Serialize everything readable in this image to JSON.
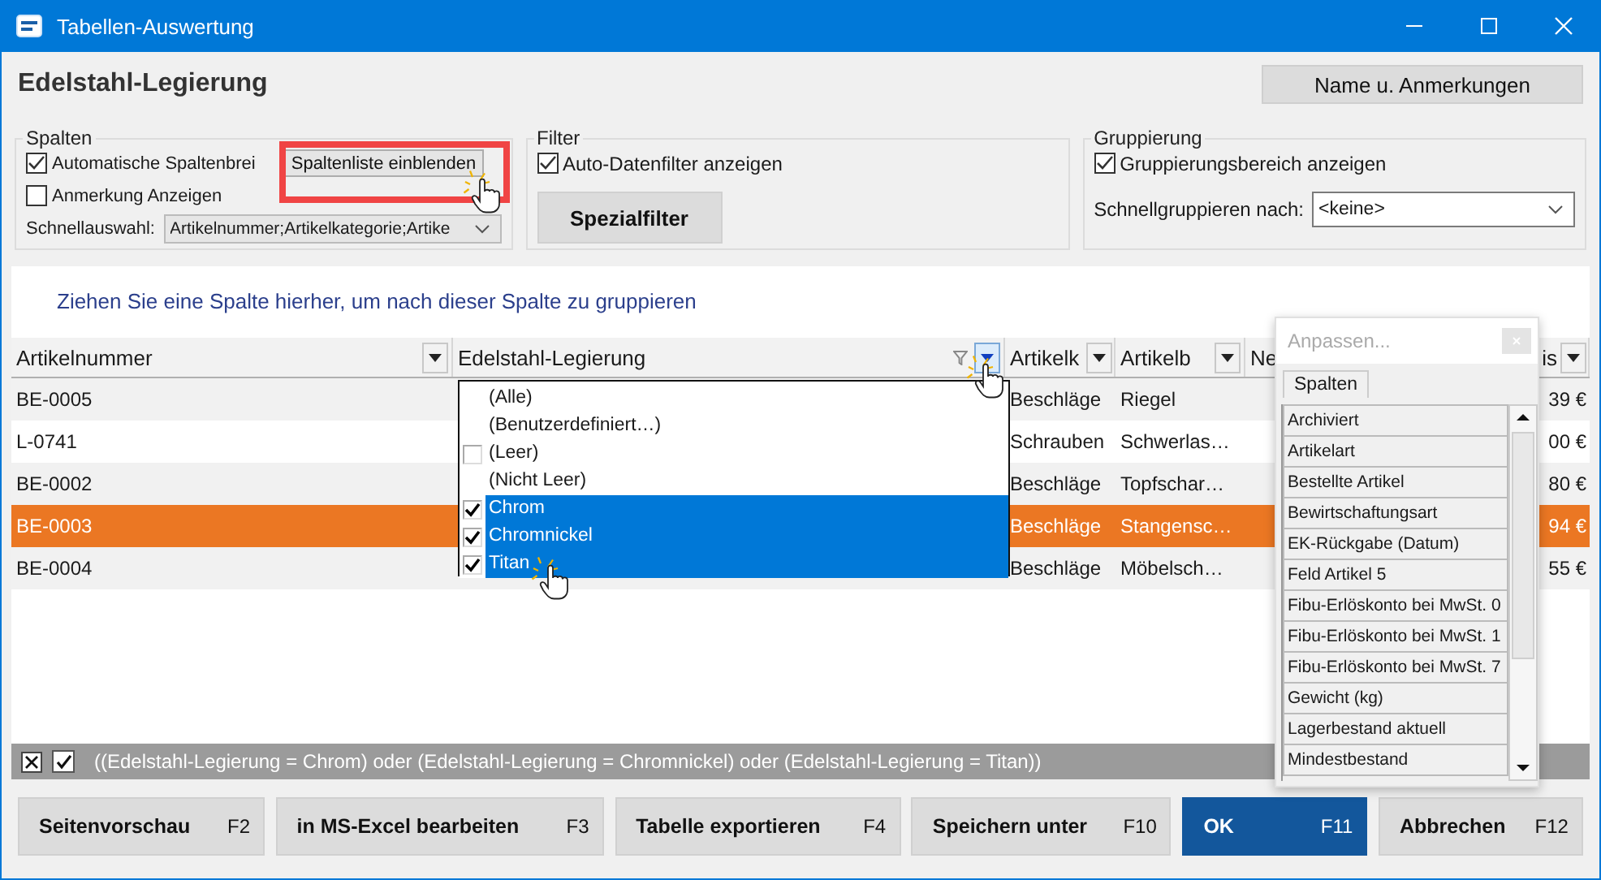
{
  "window": {
    "title": "Tabellen-Auswertung"
  },
  "header": {
    "title": "Edelstahl-Legierung",
    "button": "Name u. Anmerkungen"
  },
  "columns_group": {
    "title": "Spalten",
    "auto_width": {
      "label": "Automatische Spaltenbrei",
      "checked": true
    },
    "show_list_button": "Spaltenliste einblenden",
    "show_notes": {
      "label": "Anmerkung Anzeigen",
      "checked": false
    },
    "quick_select": {
      "label": "Schnellauswahl:",
      "value": "Artikelnummer;Artikelkategorie;Artike"
    }
  },
  "filter_group": {
    "title": "Filter",
    "auto_filter": {
      "label": "Auto-Datenfilter anzeigen",
      "checked": true
    },
    "button": "Spezialfilter"
  },
  "grouping_group": {
    "title": "Gruppierung",
    "show_area": {
      "label": "Gruppierungsbereich anzeigen",
      "checked": true
    },
    "quick_group": {
      "label": "Schnellgruppieren nach:",
      "value": "<keine>"
    }
  },
  "grid": {
    "group_hint": "Ziehen Sie eine Spalte hierher, um nach dieser Spalte zu gruppieren",
    "columns": [
      {
        "label": "Artikelnummer",
        "filter_open": false
      },
      {
        "label": "Edelstahl-Legierung",
        "filter_open": true
      },
      {
        "label": "Artikelk",
        "filter_open": false
      },
      {
        "label": "Artikelb",
        "filter_open": false
      },
      {
        "label": "Ne"
      },
      {
        "label": "is",
        "filter_open": false
      }
    ],
    "rows": [
      {
        "artikelnummer": "BE-0005",
        "artikelk": "Beschläge",
        "artikelb": "Riegel",
        "column_6": "39 €",
        "selected": false
      },
      {
        "artikelnummer": "L-0741",
        "artikelk": "Schrauben",
        "artikelb": "Schwerlas…",
        "column_6": "00 €",
        "selected": false
      },
      {
        "artikelnummer": "BE-0002",
        "artikelk": "Beschläge",
        "artikelb": "Topfschar…",
        "column_6": "80 €",
        "selected": false
      },
      {
        "artikelnummer": "BE-0003",
        "artikelk": "Beschläge",
        "artikelb": "Stangensc…",
        "column_6": "94 €",
        "selected": true
      },
      {
        "artikelnummer": "BE-0004",
        "artikelk": "Beschläge",
        "artikelb": "Möbelsch…",
        "column_6": "55 €",
        "selected": false
      }
    ]
  },
  "filter_dropdown": {
    "items": [
      {
        "kind": "option",
        "label": "(Alle)",
        "selected": false
      },
      {
        "kind": "option",
        "label": "(Benutzerdefiniert…)",
        "selected": false
      },
      {
        "kind": "checkbox",
        "label": "(Leer)",
        "checked": false,
        "selected": false
      },
      {
        "kind": "option",
        "label": "(Nicht Leer)",
        "selected": false
      },
      {
        "kind": "checkbox",
        "label": "Chrom",
        "checked": true,
        "selected": true
      },
      {
        "kind": "checkbox",
        "label": "Chromnickel",
        "checked": true,
        "selected": true
      },
      {
        "kind": "checkbox",
        "label": "Titan",
        "checked": true,
        "selected": true
      }
    ]
  },
  "customize_popup": {
    "title": "Anpassen...",
    "tab": "Spalten",
    "items": [
      "Archiviert",
      "Artikelart",
      "Bestellte Artikel",
      "Bewirtschaftungsart",
      "EK-Rückgabe (Datum)",
      "Feld Artikel 5",
      "Fibu-Erlöskonto bei MwSt. 0",
      "Fibu-Erlöskonto bei MwSt. 1",
      "Fibu-Erlöskonto bei MwSt. 7",
      "Gewicht (kg)",
      "Lagerbestand aktuell",
      "Mindestbestand"
    ]
  },
  "filter_bar": {
    "enabled": true,
    "expression": "((Edelstahl-Legierung = Chrom) oder (Edelstahl-Legierung = Chromnickel) oder (Edelstahl-Legierung = Titan))"
  },
  "buttons": [
    {
      "label": "Seitenvorschau",
      "key": "F2",
      "default": false
    },
    {
      "label": "in MS-Excel bearbeiten",
      "key": "F3",
      "default": false
    },
    {
      "label": "Tabelle exportieren",
      "key": "F4",
      "default": false
    },
    {
      "label": "Speichern unter",
      "key": "F10",
      "default": false
    },
    {
      "label": "OK",
      "key": "F11",
      "default": true
    },
    {
      "label": "Abbrechen",
      "key": "F12",
      "default": false
    }
  ]
}
